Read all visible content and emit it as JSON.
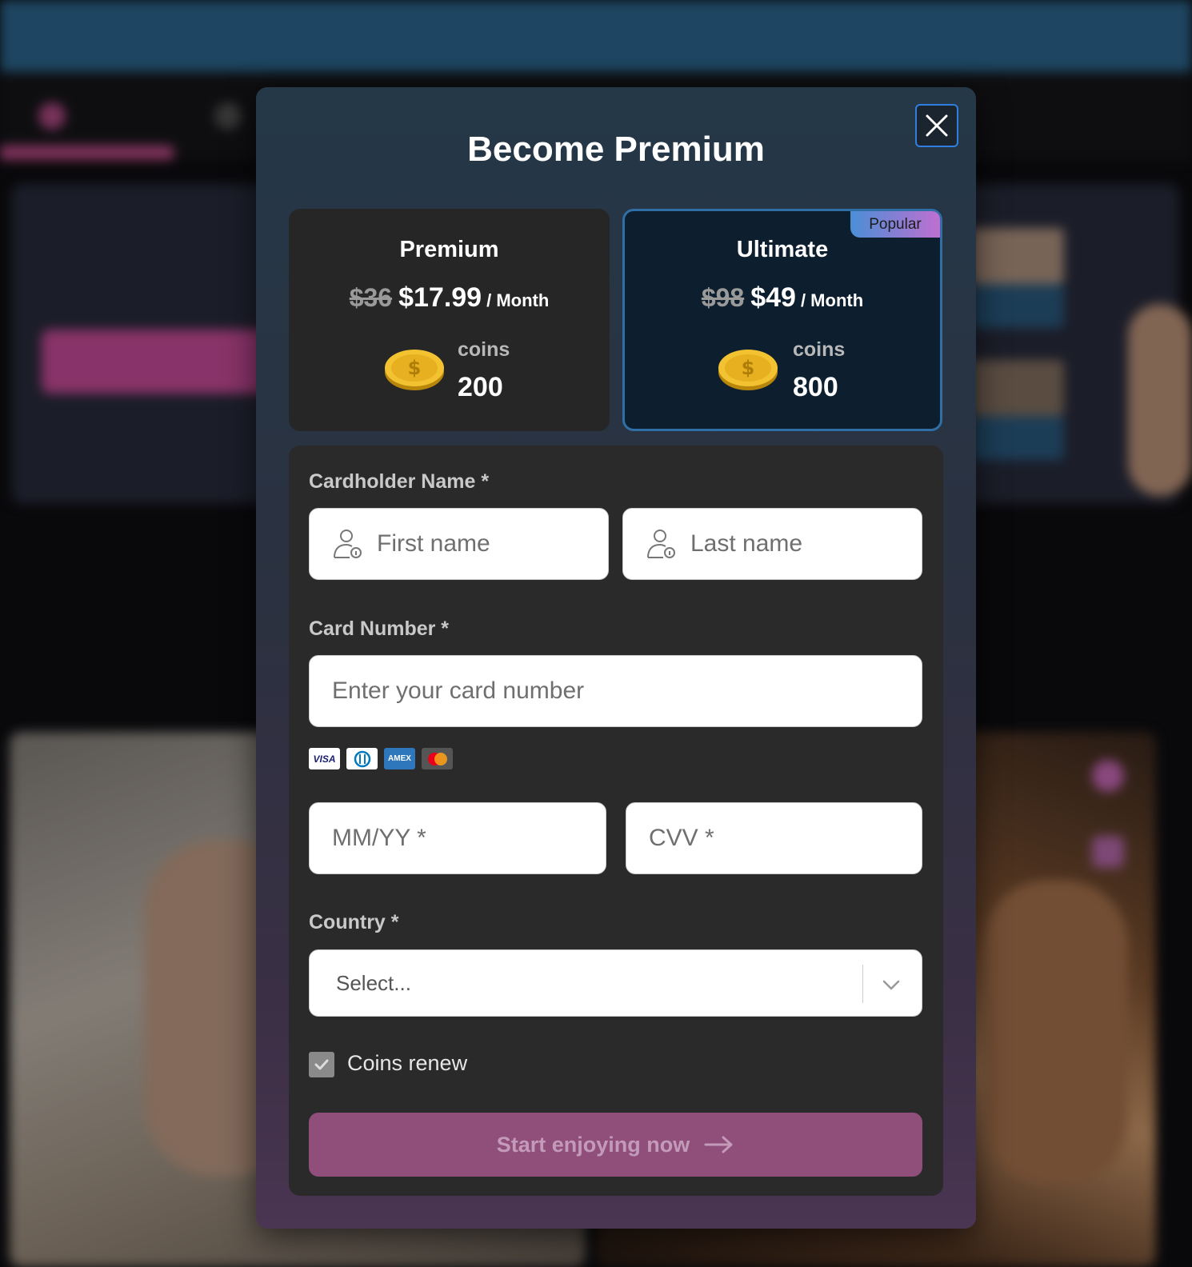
{
  "modal": {
    "title": "Become Premium"
  },
  "plans": [
    {
      "name": "Premium",
      "old_price": "$36",
      "new_price": "$17.99",
      "period": "/ Month",
      "coins_label": "coins",
      "coins": "200",
      "selected": false
    },
    {
      "name": "Ultimate",
      "badge": "Popular",
      "old_price": "$98",
      "new_price": "$49",
      "period": "/ Month",
      "coins_label": "coins",
      "coins": "800",
      "selected": true
    }
  ],
  "form": {
    "cardholder_label": "Cardholder Name *",
    "first_name_placeholder": "First name",
    "last_name_placeholder": "Last name",
    "card_number_label": "Card Number *",
    "card_number_placeholder": "Enter your card number",
    "card_brands": [
      "VISA",
      "Diners Club",
      "AMEX",
      "Mastercard"
    ],
    "expiry_placeholder": "MM/YY *",
    "cvv_placeholder": "CVV *",
    "country_label": "Country *",
    "country_value": "Select...",
    "coins_renew_label": "Coins renew",
    "coins_renew_checked": true,
    "submit_label": "Start enjoying now"
  },
  "colors": {
    "accent_pink": "#8f4f7a",
    "selected_border": "#2f6fa6",
    "close_focus": "#2f7fe0"
  }
}
